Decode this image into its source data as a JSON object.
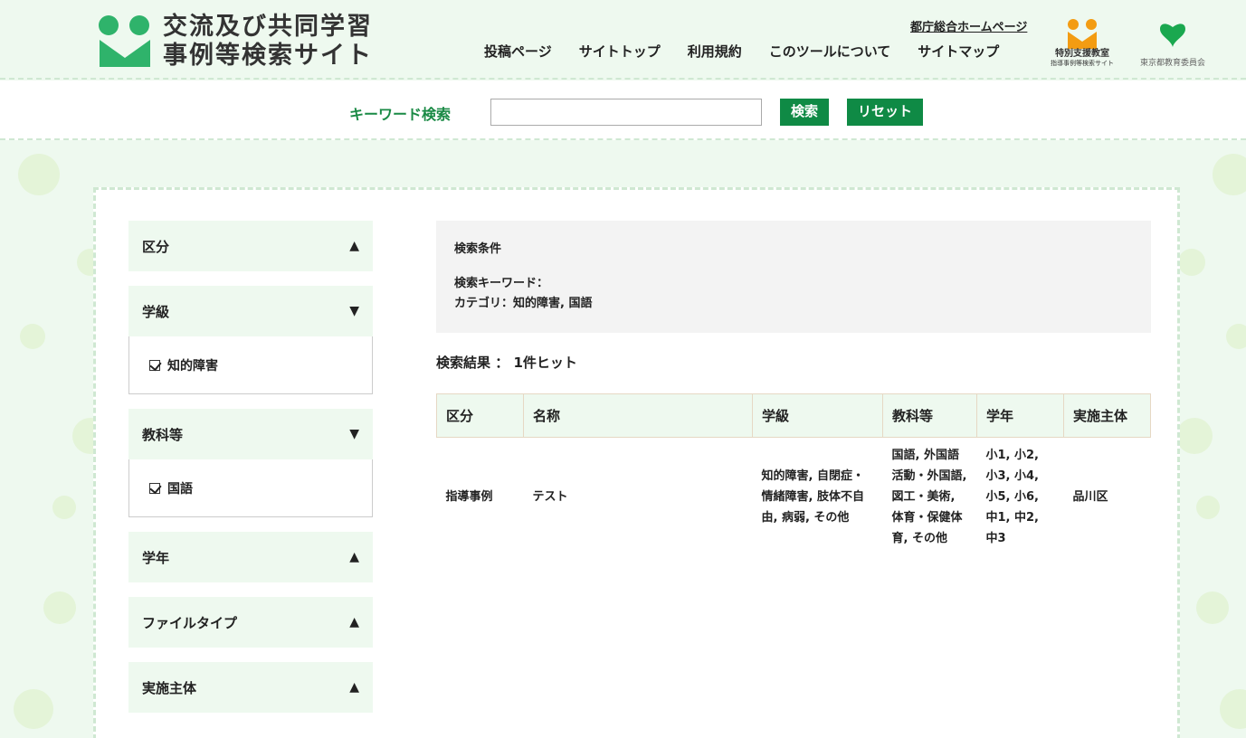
{
  "header": {
    "title_line1": "交流及び共同学習",
    "title_line2": "事例等検索サイト",
    "home_link": "都庁総合ホームページ",
    "nav": [
      "投稿ページ",
      "サイトトップ",
      "利用規約",
      "このツールについて",
      "サイトマップ"
    ],
    "sub_logo_line1": "特別支援教室",
    "sub_logo_line2": "指導事例等検索サイト",
    "tokyo_logo_text": "東京都教育委員会"
  },
  "search": {
    "label": "キーワード検索",
    "input_value": "",
    "search_button": "検索",
    "reset_button": "リセット"
  },
  "sidebar": {
    "facets": [
      {
        "label": "区分",
        "arrow": "▲",
        "expanded": false,
        "items": []
      },
      {
        "label": "学級",
        "arrow": "▼",
        "expanded": true,
        "items": [
          "知的障害"
        ]
      },
      {
        "label": "教科等",
        "arrow": "▼",
        "expanded": true,
        "items": [
          "国語"
        ]
      },
      {
        "label": "学年",
        "arrow": "▲",
        "expanded": false,
        "items": []
      },
      {
        "label": "ファイルタイプ",
        "arrow": "▲",
        "expanded": false,
        "items": []
      },
      {
        "label": "実施主体",
        "arrow": "▲",
        "expanded": false,
        "items": []
      }
    ]
  },
  "conditions": {
    "title": "検索条件",
    "keyword_line": "検索キーワード：",
    "category_line": "カテゴリ：知的障害, 国語"
  },
  "results": {
    "count_text": "検索結果 ： 1件ヒット",
    "columns": [
      "区分",
      "名称",
      "学級",
      "教科等",
      "学年",
      "実施主体"
    ],
    "rows": [
      [
        "指導事例",
        "テスト",
        "知的障害, 自閉症・情緒障害, 肢体不自由, 病弱, その他",
        "国語, 外国語活動・外国語, 図工・美術, 体育・保健体育, その他",
        "小1, 小2, 小3, 小4, 小5, 小6, 中1, 中2, 中3",
        "品川区"
      ]
    ]
  },
  "colors": {
    "brand_green": "#1a8a45",
    "button_green": "#0f8a45",
    "background": "#eef9ef",
    "logo_orange": "#f39c12"
  }
}
